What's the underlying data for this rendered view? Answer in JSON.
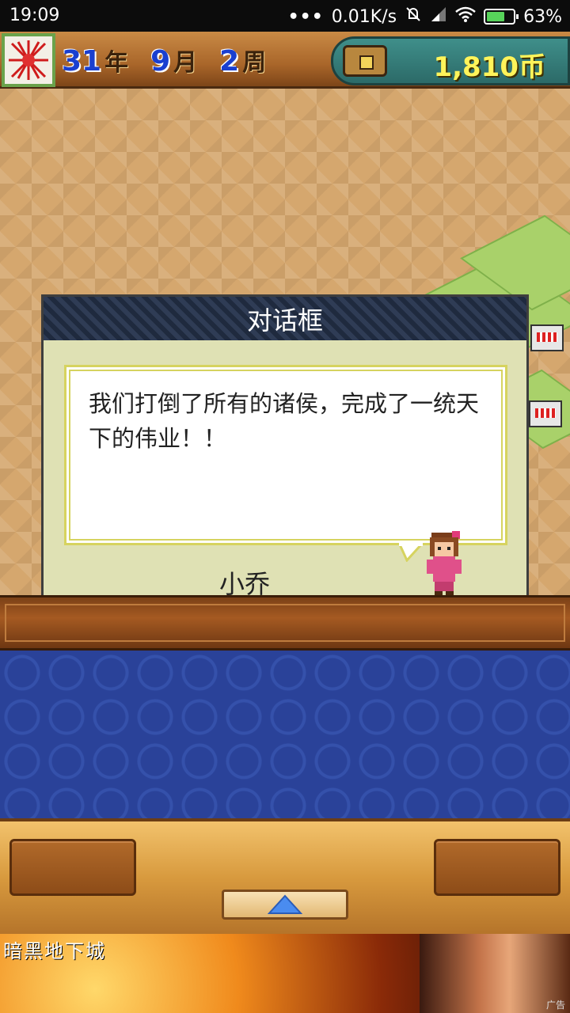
{
  "status_bar": {
    "time": "19:09",
    "network_speed": "0.01K/s",
    "battery": "63%",
    "icons": [
      "more-dots-icon",
      "mute-icon",
      "signal-icon",
      "wifi-icon",
      "battery-charging-icon"
    ]
  },
  "hud": {
    "year_num": "31",
    "year_unit": "年",
    "month_num": "9",
    "month_unit": "月",
    "week_num": "2",
    "week_unit": "周",
    "money": "1,810币",
    "icons": [
      "emblem-icon",
      "treasure-chest-icon"
    ]
  },
  "dialog": {
    "title": "对话框",
    "message": "我们打倒了所有的诸侯，完成了一统天下的伟业！！",
    "speaker": "小乔"
  },
  "controls": {
    "up_icon": "triangle-up-icon"
  },
  "ad": {
    "title": "暗黑地下城",
    "label": "广告"
  },
  "colors": {
    "date_number": "#1a3fd0",
    "money_text": "#fff45a",
    "dialog_bg": "#dfe1b4",
    "dialog_title_bg": "#273247",
    "bubble_border": "#d6d35f",
    "blue_panel": "#2a4299"
  }
}
